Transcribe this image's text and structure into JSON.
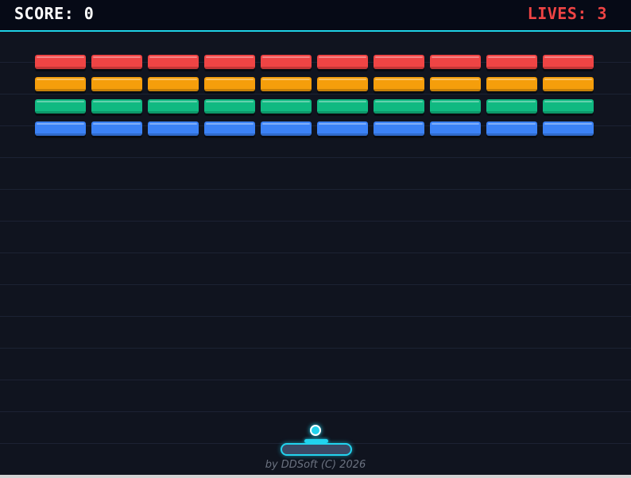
{
  "hud": {
    "score_text": "SCORE: 0",
    "lives_text": "LIVES: 3",
    "score_color": "#ffffff",
    "lives_color": "#ef4444",
    "accent_color": "#1fd2e6"
  },
  "bricks": {
    "rows": [
      {
        "color": "#ef4444",
        "count": 10
      },
      {
        "color": "#f59e0b",
        "count": 10
      },
      {
        "color": "#10b981",
        "count": 10
      },
      {
        "color": "#3b82f6",
        "count": 10
      }
    ]
  },
  "ball": {
    "color": "#22d3ee"
  },
  "paddle": {
    "color": "#22d3ee"
  },
  "footer": {
    "credits": "by DDSoft (C) 2026"
  }
}
